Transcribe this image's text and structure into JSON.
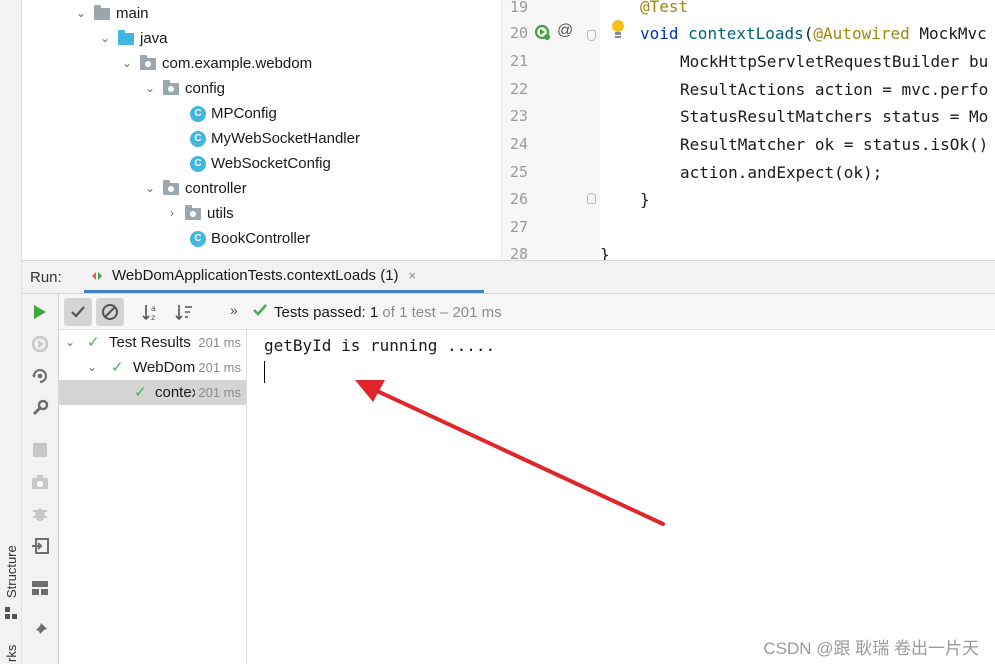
{
  "side_tabs": {
    "structure": "Structure",
    "bookmarks_partial": "rks"
  },
  "project_tree": {
    "rows": [
      {
        "label": "main",
        "icon": "folder-icon"
      },
      {
        "label": "java",
        "icon": "source-folder-icon"
      },
      {
        "label": "com.example.webdom",
        "icon": "package-icon"
      },
      {
        "label": "config",
        "icon": "package-icon"
      },
      {
        "label": "MPConfig",
        "icon": "class-icon"
      },
      {
        "label": "MyWebSocketHandler",
        "icon": "class-icon"
      },
      {
        "label": "WebSocketConfig",
        "icon": "class-icon"
      },
      {
        "label": "controller",
        "icon": "package-icon"
      },
      {
        "label": "utils",
        "icon": "package-icon"
      },
      {
        "label": "BookController",
        "icon": "class-icon"
      }
    ]
  },
  "editor": {
    "line_numbers": [
      "19",
      "20",
      "21",
      "22",
      "23",
      "24",
      "25",
      "26",
      "27",
      "28"
    ],
    "lines": {
      "l19": "@Test",
      "l20_kw": "void",
      "l20_fn": "contextLoads",
      "l20_paren": "(",
      "l20_anno": "@Autowired",
      "l20_rest": " MockMvc",
      "l21": "MockHttpServletRequestBuilder bu",
      "l22": "ResultActions action = mvc.perfo",
      "l23": "StatusResultMatchers status = Mo",
      "l24": "ResultMatcher ok = status.isOk()",
      "l25": "action.andExpect(ok);",
      "l26": "}",
      "l28": "}"
    }
  },
  "run_panel": {
    "label": "Run:",
    "tab_title": "WebDomApplicationTests.contextLoads (1)",
    "close": "×"
  },
  "test_toolbar": {
    "status_prefix": "Tests passed: ",
    "passed_count": "1",
    "status_suffix": " of 1 test – 201 ms",
    "more": "»"
  },
  "test_tree": [
    {
      "name": "Test Results",
      "time": "201 ms"
    },
    {
      "name": "WebDomApplicationTests",
      "time": "201 ms"
    },
    {
      "name": "contextLoads()",
      "time": "201 ms"
    }
  ],
  "console": {
    "output": "getById is running ....."
  },
  "watermark": "CSDN @跟 耿瑞 卷出一片天",
  "colors": {
    "accent": "#4083c9",
    "pass": "#4caf50",
    "run": "#3fa33f",
    "arrow": "#e0262b",
    "class": "#40b6e0"
  }
}
